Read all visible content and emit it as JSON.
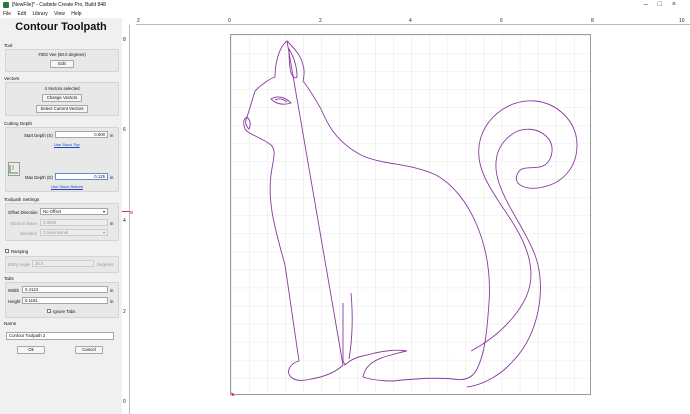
{
  "window": {
    "title": "[NewFile]* - Carbide Create Pro, Build 848"
  },
  "menu": {
    "items": [
      "File",
      "Edit",
      "Library",
      "View",
      "Help"
    ]
  },
  "panel": {
    "title": "Contour Toolpath",
    "tool": {
      "section": "Tool",
      "name": "#302 Vee (60.0 degrees)",
      "edit_label": "Edit"
    },
    "vectors": {
      "section": "Vectors",
      "status": "4 Vectors selected",
      "change_label": "Change Vectors",
      "select_current_label": "Select Current Vectors"
    },
    "cutting_depth": {
      "section": "Cutting Depth",
      "start_label": "Start Depth (S)",
      "start_value": "0.000",
      "start_unit": "in",
      "use_stock_top": "Use Stock Top",
      "max_label": "Max Depth (D)",
      "max_value": "0.125",
      "max_unit": "in",
      "use_stock_bottom": "Use Stock Bottom"
    },
    "toolpath_settings": {
      "section": "Toolpath Settings",
      "offset_label": "Offset Direction",
      "offset_value": "No Offset",
      "stock_label": "Stock to leave",
      "stock_value": "0.0000",
      "stock_unit": "in",
      "direction_label": "Direction",
      "direction_value": "Conventional"
    },
    "ramping": {
      "label": "Ramping",
      "checked": false,
      "entry_label": "Entry Angle",
      "entry_value": "25.0",
      "entry_unit": "Degrees"
    },
    "tabs": {
      "section": "Tabs",
      "width_label": "Width",
      "width_value": "0.4124",
      "width_unit": "in",
      "height_label": "Height",
      "height_value": "0.1181",
      "height_unit": "in",
      "ignore_label": "Ignore Tabs",
      "ignore_checked": false
    },
    "name": {
      "section": "Name",
      "value": "Contour Toolpath 2"
    },
    "ok_label": "Ok",
    "cancel_label": "Cancel"
  },
  "ruler": {
    "top_labels": [
      "2",
      "0",
      "2",
      "4",
      "6",
      "8",
      "10"
    ],
    "left_labels": [
      "8",
      "6",
      "4",
      "2",
      "0"
    ]
  },
  "colors": {
    "vector": "#8a3aa0",
    "grid": "#d6d6d6",
    "origin": "#e02020"
  }
}
